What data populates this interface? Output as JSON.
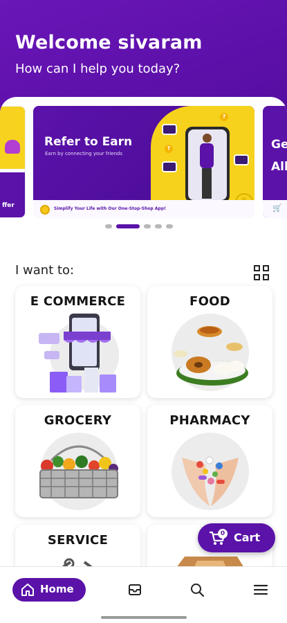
{
  "header": {
    "welcome": "Welcome sivaram",
    "subtitle": "How can I help you today?"
  },
  "carousel": {
    "main": {
      "title": "Refer to Earn",
      "subtitle": "Earn by connecting your friends",
      "tagline": "Simplify Your Life with Our One-Stop-Shop App!"
    },
    "right_peek_text": "Ge All",
    "left_peek_text": "ffer",
    "active_index": 1,
    "dot_count": 5
  },
  "section": {
    "label": "I want to:"
  },
  "categories": [
    {
      "label": "E COMMERCE"
    },
    {
      "label": "FOOD"
    },
    {
      "label": "GROCERY"
    },
    {
      "label": "PHARMACY"
    },
    {
      "label": "SERVICE"
    },
    {
      "label": ""
    }
  ],
  "cart": {
    "label": "Cart",
    "count": "0"
  },
  "bottom_nav": {
    "home_label": "Home",
    "items": [
      "Home",
      "Orders",
      "Search",
      "Menu"
    ]
  },
  "colors": {
    "brand": "#5a12a8",
    "accent_yellow": "#f6d21c"
  }
}
